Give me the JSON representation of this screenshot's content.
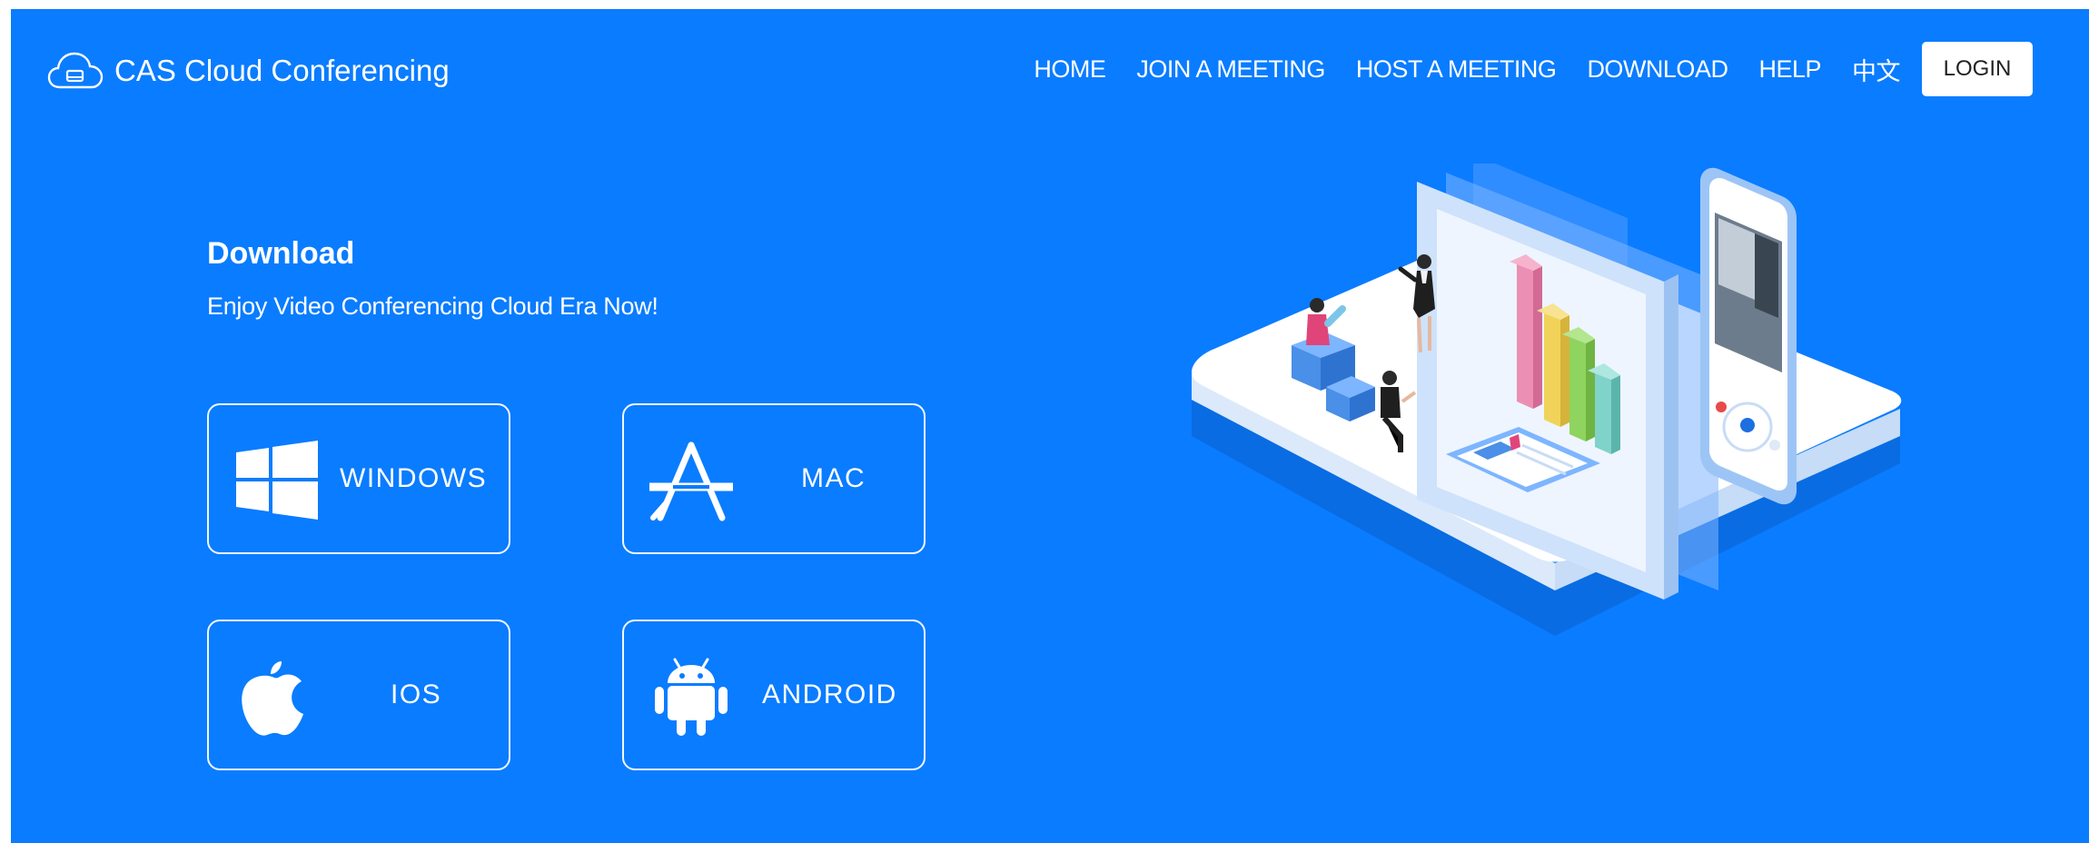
{
  "header": {
    "brand_name": "CAS Cloud Conferencing",
    "brand_icon": "cloud-icon",
    "nav": {
      "home": "HOME",
      "join": "JOIN A MEETING",
      "host": "HOST A MEETING",
      "download": "DOWNLOAD",
      "help": "HELP",
      "language": "中文",
      "login": "LOGIN"
    }
  },
  "hero": {
    "title": "Download",
    "subtitle": "Enjoy Video Conferencing Cloud Era Now!"
  },
  "downloads": {
    "windows": {
      "label": "WINDOWS",
      "icon": "windows-icon"
    },
    "mac": {
      "label": "MAC",
      "icon": "app-store-icon"
    },
    "ios": {
      "label": "IOS",
      "icon": "apple-icon"
    },
    "android": {
      "label": "ANDROID",
      "icon": "android-icon"
    }
  },
  "colors": {
    "background": "#0a7cff",
    "text": "#ffffff",
    "login_bg": "#ffffff"
  }
}
